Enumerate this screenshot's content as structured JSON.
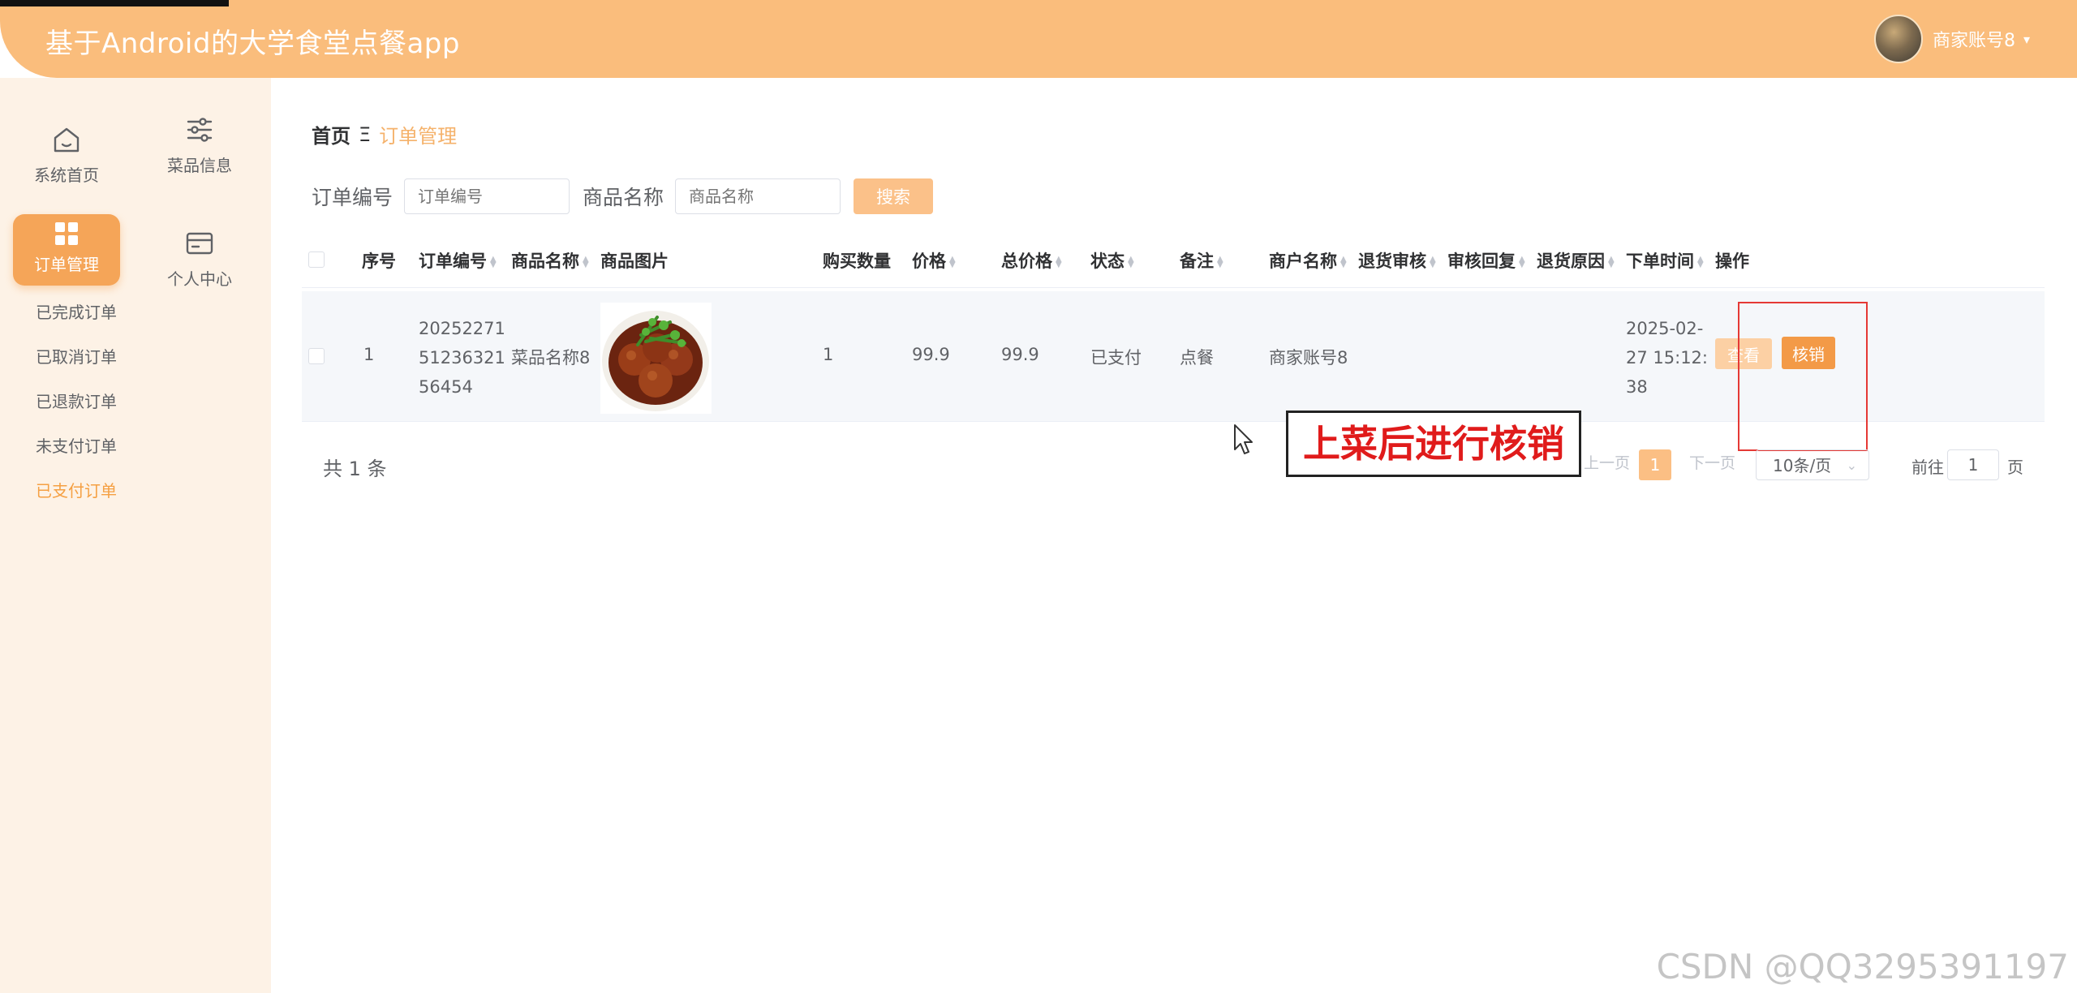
{
  "header": {
    "title": "基于Android的大学食堂点餐app",
    "user_name": "商家账号8",
    "caret": "▾"
  },
  "sidebar": {
    "tiles": {
      "home": "系统首页",
      "dish": "菜品信息",
      "order": "订单管理",
      "center": "个人中心"
    },
    "sub_items": [
      "已完成订单",
      "已取消订单",
      "已退款订单",
      "未支付订单",
      "已支付订单"
    ]
  },
  "breadcrumb": {
    "home": "首页",
    "separator": "Ξ",
    "current": "订单管理"
  },
  "search": {
    "order_no_label": "订单编号",
    "order_no_placeholder": "订单编号",
    "dish_name_label": "商品名称",
    "dish_name_placeholder": "商品名称",
    "button": "搜索"
  },
  "table": {
    "columns": {
      "index": "序号",
      "order_no": "订单编号",
      "dish_name": "商品名称",
      "dish_image": "商品图片",
      "quantity": "购买数量",
      "price": "价格",
      "total": "总价格",
      "status": "状态",
      "remark": "备注",
      "merchant": "商户名称",
      "refund_review": "退货审核",
      "review_reply": "审核回复",
      "refund_reason": "退货原因",
      "order_time": "下单时间",
      "actions": "操作"
    },
    "rows": [
      {
        "index": "1",
        "order_no_1": "20252271",
        "order_no_2": "51236321",
        "order_no_3": "56454",
        "dish_name": "菜品名称8",
        "quantity": "1",
        "price": "99.9",
        "total": "99.9",
        "status": "已支付",
        "remark": "点餐",
        "merchant": "商家账号8",
        "refund_review": "",
        "review_reply": "",
        "refund_reason": "",
        "time_1": "2025-02-",
        "time_2": "27 15:12:",
        "time_3": "38",
        "view_btn": "查看",
        "verify_btn": "核销"
      }
    ]
  },
  "pagination": {
    "total": "共 1 条",
    "prev": "上一页",
    "current_page": "1",
    "next": "下一页",
    "page_size": "10条/页",
    "goto_label": "前往",
    "goto_value": "1",
    "goto_unit": "页"
  },
  "annotation": {
    "text": "上菜后进行核销"
  },
  "watermark": "CSDN @QQ3295391197",
  "colors": {
    "header": "#fabd7c",
    "accent": "#f5a043",
    "sidebar_bg": "#fdf2e6",
    "annotation_red": "#e01b1b"
  }
}
